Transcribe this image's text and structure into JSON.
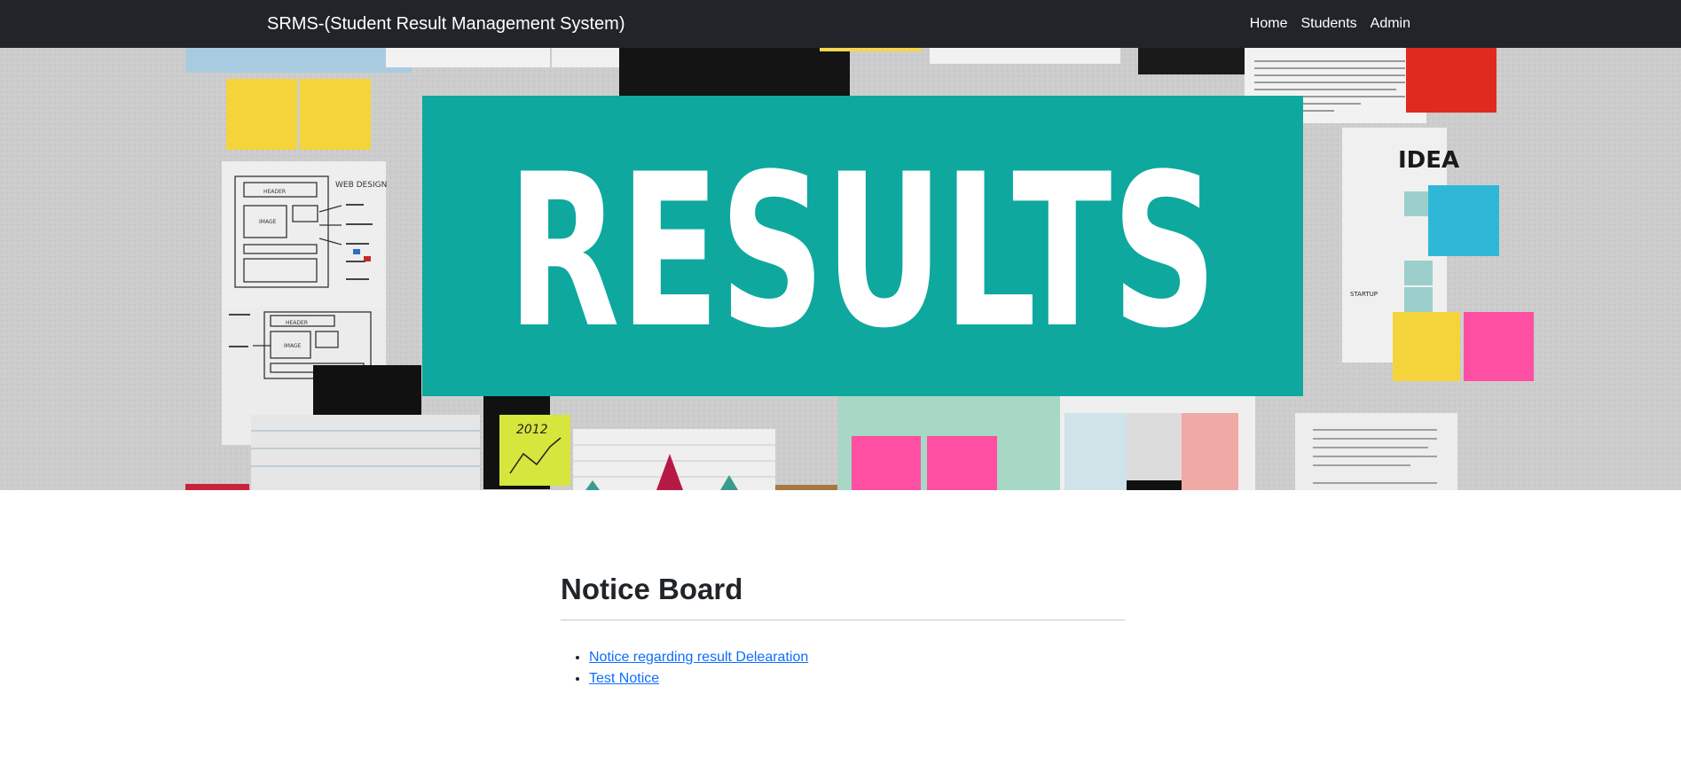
{
  "navbar": {
    "brand": "SRMS-(Student Result Management System)",
    "links": [
      "Home",
      "Students",
      "Admin"
    ]
  },
  "hero": {
    "banner_text": "RESULTS",
    "colors": {
      "banner": "#0fa89e",
      "wall": "#cfcfcf"
    },
    "sketch_texts": {
      "web_design": "WEB DESIGN",
      "header": "HEADER",
      "image": "IMAGE",
      "sticky_year": "2012",
      "idea": "IDEA",
      "startup": "STARTUP"
    }
  },
  "notice_board": {
    "title": "Notice Board",
    "items": [
      "Notice regarding result Delearation",
      "Test Notice"
    ]
  }
}
